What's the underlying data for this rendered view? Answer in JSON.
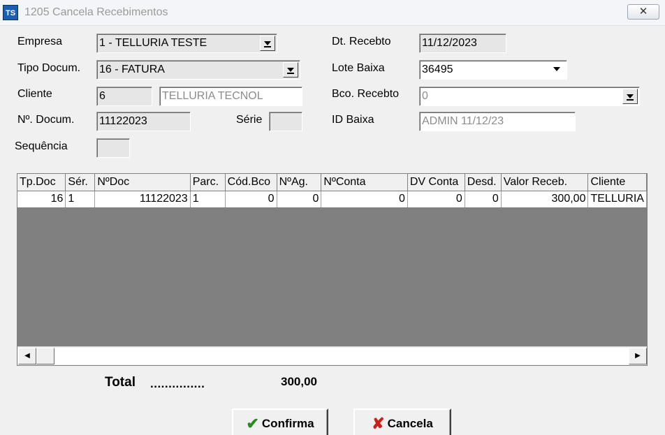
{
  "window": {
    "title": "1205 Cancela Recebimentos",
    "app_icon": "TS",
    "close_glyph": "✕"
  },
  "form": {
    "empresa_label": "Empresa",
    "empresa_value": "1 - TELLURIA TESTE",
    "tipo_label": "Tipo Docum.",
    "tipo_value": "16 - FATURA",
    "cliente_label": "Cliente",
    "cliente_code": "6",
    "cliente_name": "TELLURIA TECNOL",
    "ndoc_label": "Nº. Docum.",
    "ndoc_value": "11122023",
    "serie_label": "Série",
    "serie_value": "",
    "seq_label": "Sequência",
    "seq_value": "",
    "dtrec_label": "Dt. Recebto",
    "dtrec_value": "11/12/2023",
    "lote_label": "Lote Baixa",
    "lote_value": "36495",
    "bco_label": "Bco. Recebto",
    "bco_value": "0",
    "idbaixa_label": "ID Baixa",
    "idbaixa_value": "ADMIN 11/12/23"
  },
  "grid": {
    "columns": [
      "Tp.Doc",
      "Sér.",
      "NºDoc",
      "Parc.",
      "Cód.Bco",
      "NºAg.",
      "NºConta",
      "DV Conta",
      "Desd.",
      "Valor Receb.",
      "Cliente"
    ],
    "rows": [
      [
        "16",
        "1",
        "11122023",
        "1",
        "0",
        "0",
        "0",
        "0",
        "0",
        "300,00",
        "TELLURIA"
      ]
    ]
  },
  "totals": {
    "label": "Total",
    "dots": "...............",
    "value": "300,00"
  },
  "buttons": {
    "confirm": "Confirma",
    "cancel": "Cancela"
  },
  "icons": {
    "confirm": "check-icon",
    "cancel": "x-icon",
    "dropdown": "chevron-down-icon"
  }
}
